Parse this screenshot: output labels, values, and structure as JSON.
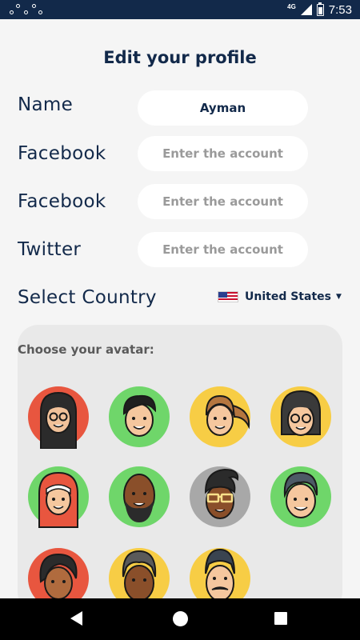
{
  "status_bar": {
    "network": "4G",
    "time": "7:53"
  },
  "page": {
    "title": "Edit your profile"
  },
  "form": {
    "name": {
      "label": "Name",
      "value": "Ayman"
    },
    "facebook_1": {
      "label": "Facebook",
      "placeholder": "Enter the account"
    },
    "facebook_2": {
      "label": "Facebook",
      "placeholder": "Enter the account"
    },
    "twitter": {
      "label": "Twitter",
      "placeholder": "Enter the account"
    },
    "country": {
      "label": "Select Country",
      "selected": "United States",
      "flag_icon": "us-flag-icon"
    }
  },
  "avatars": {
    "title": "Choose your avatar:",
    "items": [
      {
        "icon": "avatar-woman-hijab-glasses",
        "bg": "#e8563f"
      },
      {
        "icon": "avatar-man-black-hair",
        "bg": "#6fd66a"
      },
      {
        "icon": "avatar-woman-ponytail",
        "bg": "#f7cd45"
      },
      {
        "icon": "avatar-woman-glasses-dark-hair",
        "bg": "#f7cd45"
      },
      {
        "icon": "avatar-woman-red-hijab",
        "bg": "#6fd66a"
      },
      {
        "icon": "avatar-man-bald-beard",
        "bg": "#6fd66a"
      },
      {
        "icon": "avatar-man-glasses-quiff",
        "bg": "#a8a8a8"
      },
      {
        "icon": "avatar-man-grey-hair",
        "bg": "#6fd66a"
      },
      {
        "icon": "avatar-woman-dark-short-hair",
        "bg": "#e8563f"
      },
      {
        "icon": "avatar-man-grey-hair-dark-skin",
        "bg": "#f7cd45"
      },
      {
        "icon": "avatar-man-mustache",
        "bg": "#f7cd45"
      }
    ]
  },
  "colors": {
    "navy": "#12294a",
    "background": "#f5f5f5",
    "panel": "#e9e9e9",
    "placeholder": "#9a9a9a"
  }
}
